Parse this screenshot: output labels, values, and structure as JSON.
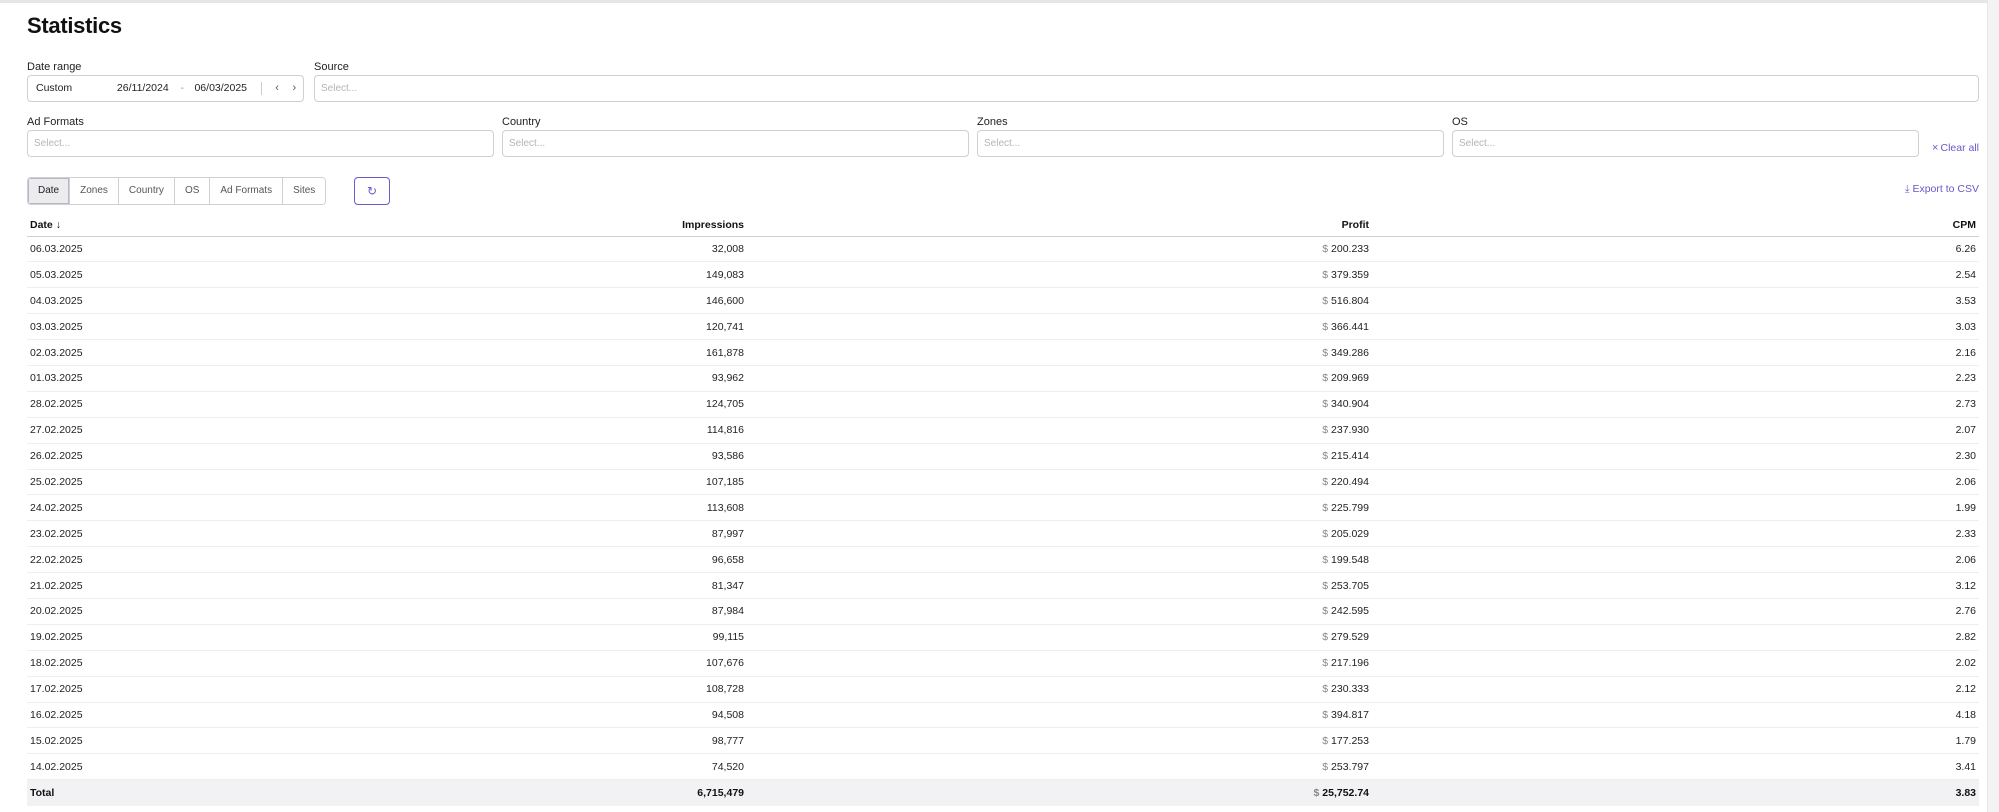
{
  "title": "Statistics",
  "filters": {
    "date_range_label": "Date range",
    "date_preset": "Custom",
    "date_from": "26/11/2024",
    "date_sep": "-",
    "date_to": "06/03/2025",
    "prev_glyph": "‹",
    "next_glyph": "›",
    "source_label": "Source",
    "source_placeholder": "Select...",
    "ad_formats_label": "Ad Formats",
    "ad_formats_placeholder": "Select...",
    "country_label": "Country",
    "country_placeholder": "Select...",
    "zones_label": "Zones",
    "zones_placeholder": "Select...",
    "os_label": "OS",
    "os_placeholder": "Select...",
    "clear_all": "Clear all",
    "clear_glyph": "×"
  },
  "toolbar": {
    "tabs": [
      "Date",
      "Zones",
      "Country",
      "OS",
      "Ad Formats",
      "Sites"
    ],
    "active_tab": "Date",
    "refresh_glyph": "↻",
    "export_glyph": "⤓",
    "export_label": "Export to CSV"
  },
  "colors": {
    "accent": "#6b58c9"
  },
  "table": {
    "headers": {
      "date": "Date",
      "sort_glyph": "↓",
      "impressions": "Impressions",
      "profit": "Profit",
      "cpm": "CPM"
    },
    "currency": "$",
    "rows": [
      {
        "date": "06.03.2025",
        "impressions": "32,008",
        "profit": "200.233",
        "cpm": "6.26"
      },
      {
        "date": "05.03.2025",
        "impressions": "149,083",
        "profit": "379.359",
        "cpm": "2.54"
      },
      {
        "date": "04.03.2025",
        "impressions": "146,600",
        "profit": "516.804",
        "cpm": "3.53"
      },
      {
        "date": "03.03.2025",
        "impressions": "120,741",
        "profit": "366.441",
        "cpm": "3.03"
      },
      {
        "date": "02.03.2025",
        "impressions": "161,878",
        "profit": "349.286",
        "cpm": "2.16"
      },
      {
        "date": "01.03.2025",
        "impressions": "93,962",
        "profit": "209.969",
        "cpm": "2.23"
      },
      {
        "date": "28.02.2025",
        "impressions": "124,705",
        "profit": "340.904",
        "cpm": "2.73"
      },
      {
        "date": "27.02.2025",
        "impressions": "114,816",
        "profit": "237.930",
        "cpm": "2.07"
      },
      {
        "date": "26.02.2025",
        "impressions": "93,586",
        "profit": "215.414",
        "cpm": "2.30"
      },
      {
        "date": "25.02.2025",
        "impressions": "107,185",
        "profit": "220.494",
        "cpm": "2.06"
      },
      {
        "date": "24.02.2025",
        "impressions": "113,608",
        "profit": "225.799",
        "cpm": "1.99"
      },
      {
        "date": "23.02.2025",
        "impressions": "87,997",
        "profit": "205.029",
        "cpm": "2.33"
      },
      {
        "date": "22.02.2025",
        "impressions": "96,658",
        "profit": "199.548",
        "cpm": "2.06"
      },
      {
        "date": "21.02.2025",
        "impressions": "81,347",
        "profit": "253.705",
        "cpm": "3.12"
      },
      {
        "date": "20.02.2025",
        "impressions": "87,984",
        "profit": "242.595",
        "cpm": "2.76"
      },
      {
        "date": "19.02.2025",
        "impressions": "99,115",
        "profit": "279.529",
        "cpm": "2.82"
      },
      {
        "date": "18.02.2025",
        "impressions": "107,676",
        "profit": "217.196",
        "cpm": "2.02"
      },
      {
        "date": "17.02.2025",
        "impressions": "108,728",
        "profit": "230.333",
        "cpm": "2.12"
      },
      {
        "date": "16.02.2025",
        "impressions": "94,508",
        "profit": "394.817",
        "cpm": "4.18"
      },
      {
        "date": "15.02.2025",
        "impressions": "98,777",
        "profit": "177.253",
        "cpm": "1.79"
      },
      {
        "date": "14.02.2025",
        "impressions": "74,520",
        "profit": "253.797",
        "cpm": "3.41"
      }
    ],
    "total": {
      "label": "Total",
      "impressions": "6,715,479",
      "profit": "25,752.74",
      "cpm": "3.83"
    }
  }
}
